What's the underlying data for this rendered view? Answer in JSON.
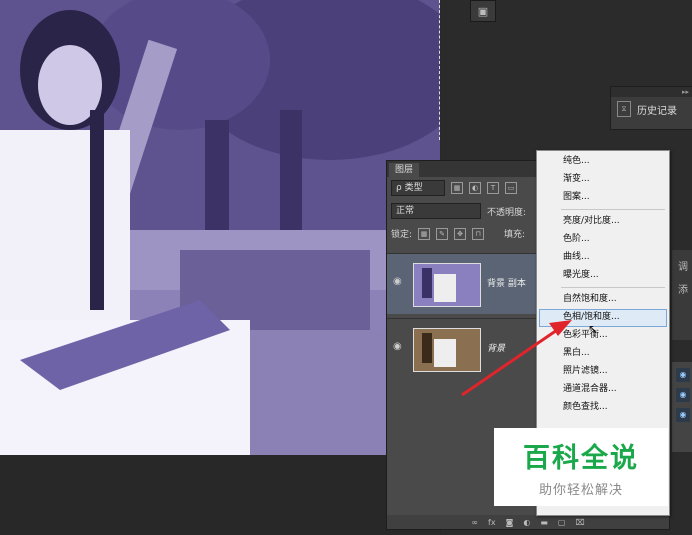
{
  "history_panel": {
    "label": "历史记录",
    "collapse": "▸▸"
  },
  "layers_panel": {
    "tab": "图层",
    "filter": "ρ 类型",
    "blend_mode": "正常",
    "opacity_label": "不透明度:",
    "lock_label": "锁定:",
    "fill_label": "填充:",
    "layers": [
      {
        "name": "背景 副本",
        "selected": true
      },
      {
        "name": "背景",
        "selected": false
      }
    ],
    "bottom_icons": [
      "link-icon",
      "fx-icon",
      "mask-icon",
      "adjustment-icon",
      "folder-icon",
      "new-layer-icon",
      "trash-icon"
    ]
  },
  "adjustment_menu": {
    "items": [
      "纯色...",
      "渐变...",
      "图案...",
      "亮度/对比度...",
      "色阶...",
      "曲线...",
      "曝光度...",
      "自然饱和度...",
      "色相/饱和度...",
      "色彩平衡...",
      "黑白...",
      "照片滤镜...",
      "通道混合器...",
      "颜色查找..."
    ],
    "highlighted": "色相/饱和度..."
  },
  "edge_panel": {
    "labels": [
      "调",
      "添"
    ]
  },
  "watermark": {
    "title": "百科全说",
    "subtitle": "助你轻松解决"
  },
  "colors": {
    "accent_arrow": "#e0242c",
    "watermark_green": "#1aa84a",
    "photo_tint": "#7a6fa6"
  }
}
